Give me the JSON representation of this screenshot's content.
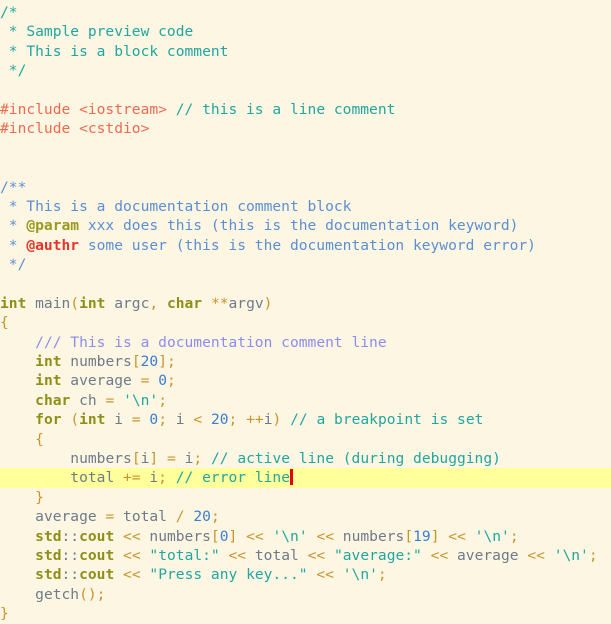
{
  "editor": {
    "name": "code-preview-pane",
    "language": "C++",
    "background_color": "#fdf6e3",
    "highlight_color": "#ffff9c",
    "caret_color": "#e8000d",
    "colors": {
      "comment": "#21a6a0",
      "doc_comment": "#5b8fd4",
      "doc_comment_line": "#8d8df0",
      "doc_keyword": "#9a9a1f",
      "doc_keyword_error": "#e8332a",
      "keyword": "#8f8f18",
      "preprocessor": "#f06a50",
      "number": "#3a7ecf",
      "string": "#21a6a0",
      "punctuation": "#c9942c",
      "identifier": "#6e7b8b"
    }
  },
  "lines": [
    {
      "highlight": false,
      "caret": false,
      "tokens": [
        {
          "t": "/*",
          "c": "comment"
        }
      ]
    },
    {
      "highlight": false,
      "caret": false,
      "tokens": [
        {
          "t": " * Sample preview code",
          "c": "comment"
        }
      ]
    },
    {
      "highlight": false,
      "caret": false,
      "tokens": [
        {
          "t": " * This is a block comment",
          "c": "comment"
        }
      ]
    },
    {
      "highlight": false,
      "caret": false,
      "tokens": [
        {
          "t": " */",
          "c": "comment"
        }
      ]
    },
    {
      "highlight": false,
      "caret": false,
      "tokens": [
        {
          "t": "",
          "c": "plain"
        }
      ]
    },
    {
      "highlight": false,
      "caret": false,
      "tokens": [
        {
          "t": "#include <iostream> ",
          "c": "preproc"
        },
        {
          "t": "// this is a line comment",
          "c": "comment"
        }
      ]
    },
    {
      "highlight": false,
      "caret": false,
      "tokens": [
        {
          "t": "#include <cstdio>",
          "c": "preproc"
        }
      ]
    },
    {
      "highlight": false,
      "caret": false,
      "tokens": [
        {
          "t": "",
          "c": "plain"
        }
      ]
    },
    {
      "highlight": false,
      "caret": false,
      "tokens": [
        {
          "t": "",
          "c": "plain"
        }
      ]
    },
    {
      "highlight": false,
      "caret": false,
      "tokens": [
        {
          "t": "/**",
          "c": "doc"
        }
      ]
    },
    {
      "highlight": false,
      "caret": false,
      "tokens": [
        {
          "t": " * This is a documentation comment block",
          "c": "doc"
        }
      ]
    },
    {
      "highlight": false,
      "caret": false,
      "tokens": [
        {
          "t": " * ",
          "c": "doc"
        },
        {
          "t": "@param",
          "c": "dockey"
        },
        {
          "t": " xxx does this (this is the documentation keyword)",
          "c": "doc"
        }
      ]
    },
    {
      "highlight": false,
      "caret": false,
      "tokens": [
        {
          "t": " * ",
          "c": "doc"
        },
        {
          "t": "@authr",
          "c": "dockeyerr"
        },
        {
          "t": " some user (this is the documentation keyword error)",
          "c": "doc"
        }
      ]
    },
    {
      "highlight": false,
      "caret": false,
      "tokens": [
        {
          "t": " */",
          "c": "doc"
        }
      ]
    },
    {
      "highlight": false,
      "caret": false,
      "tokens": [
        {
          "t": "",
          "c": "plain"
        }
      ]
    },
    {
      "highlight": false,
      "caret": false,
      "tokens": [
        {
          "t": "int",
          "c": "keyword"
        },
        {
          "t": " main",
          "c": "ident"
        },
        {
          "t": "(",
          "c": "punct"
        },
        {
          "t": "int",
          "c": "keyword"
        },
        {
          "t": " argc",
          "c": "ident"
        },
        {
          "t": ",",
          "c": "punct"
        },
        {
          "t": " ",
          "c": "plain"
        },
        {
          "t": "char",
          "c": "keyword"
        },
        {
          "t": " ",
          "c": "plain"
        },
        {
          "t": "**",
          "c": "op"
        },
        {
          "t": "argv",
          "c": "ident"
        },
        {
          "t": ")",
          "c": "punct"
        }
      ]
    },
    {
      "highlight": false,
      "caret": false,
      "tokens": [
        {
          "t": "{",
          "c": "punct"
        }
      ]
    },
    {
      "highlight": false,
      "caret": false,
      "tokens": [
        {
          "t": "    ",
          "c": "plain"
        },
        {
          "t": "/// This is a documentation comment line",
          "c": "docline"
        }
      ]
    },
    {
      "highlight": false,
      "caret": false,
      "tokens": [
        {
          "t": "    ",
          "c": "plain"
        },
        {
          "t": "int",
          "c": "keyword"
        },
        {
          "t": " numbers",
          "c": "ident"
        },
        {
          "t": "[",
          "c": "punct"
        },
        {
          "t": "20",
          "c": "number"
        },
        {
          "t": "]",
          "c": "punct"
        },
        {
          "t": ";",
          "c": "punct"
        }
      ]
    },
    {
      "highlight": false,
      "caret": false,
      "tokens": [
        {
          "t": "    ",
          "c": "plain"
        },
        {
          "t": "int",
          "c": "keyword"
        },
        {
          "t": " average ",
          "c": "ident"
        },
        {
          "t": "=",
          "c": "op"
        },
        {
          "t": " ",
          "c": "plain"
        },
        {
          "t": "0",
          "c": "number"
        },
        {
          "t": ";",
          "c": "punct"
        }
      ]
    },
    {
      "highlight": false,
      "caret": false,
      "tokens": [
        {
          "t": "    ",
          "c": "plain"
        },
        {
          "t": "char",
          "c": "keyword"
        },
        {
          "t": " ch ",
          "c": "ident"
        },
        {
          "t": "=",
          "c": "op"
        },
        {
          "t": " ",
          "c": "plain"
        },
        {
          "t": "'\\n'",
          "c": "string"
        },
        {
          "t": ";",
          "c": "punct"
        }
      ]
    },
    {
      "highlight": false,
      "caret": false,
      "tokens": [
        {
          "t": "    ",
          "c": "plain"
        },
        {
          "t": "for",
          "c": "keyword"
        },
        {
          "t": " ",
          "c": "plain"
        },
        {
          "t": "(",
          "c": "punct"
        },
        {
          "t": "int",
          "c": "keyword"
        },
        {
          "t": " i ",
          "c": "ident"
        },
        {
          "t": "=",
          "c": "op"
        },
        {
          "t": " ",
          "c": "plain"
        },
        {
          "t": "0",
          "c": "number"
        },
        {
          "t": ";",
          "c": "punct"
        },
        {
          "t": " i ",
          "c": "ident"
        },
        {
          "t": "<",
          "c": "op"
        },
        {
          "t": " ",
          "c": "plain"
        },
        {
          "t": "20",
          "c": "number"
        },
        {
          "t": ";",
          "c": "punct"
        },
        {
          "t": " ",
          "c": "plain"
        },
        {
          "t": "++",
          "c": "op"
        },
        {
          "t": "i",
          "c": "ident"
        },
        {
          "t": ")",
          "c": "punct"
        },
        {
          "t": " ",
          "c": "plain"
        },
        {
          "t": "// a breakpoint is set",
          "c": "comment"
        }
      ]
    },
    {
      "highlight": false,
      "caret": false,
      "tokens": [
        {
          "t": "    ",
          "c": "plain"
        },
        {
          "t": "{",
          "c": "punct"
        }
      ]
    },
    {
      "highlight": false,
      "caret": false,
      "tokens": [
        {
          "t": "        ",
          "c": "plain"
        },
        {
          "t": "numbers",
          "c": "ident"
        },
        {
          "t": "[",
          "c": "punct"
        },
        {
          "t": "i",
          "c": "ident"
        },
        {
          "t": "]",
          "c": "punct"
        },
        {
          "t": " ",
          "c": "plain"
        },
        {
          "t": "=",
          "c": "op"
        },
        {
          "t": " i",
          "c": "ident"
        },
        {
          "t": ";",
          "c": "punct"
        },
        {
          "t": " ",
          "c": "plain"
        },
        {
          "t": "// active line (during debugging)",
          "c": "comment"
        }
      ]
    },
    {
      "highlight": true,
      "caret": true,
      "tokens": [
        {
          "t": "        ",
          "c": "plain"
        },
        {
          "t": "total ",
          "c": "ident"
        },
        {
          "t": "+=",
          "c": "op"
        },
        {
          "t": " i",
          "c": "ident"
        },
        {
          "t": ";",
          "c": "punct"
        },
        {
          "t": " ",
          "c": "plain"
        },
        {
          "t": "// error line",
          "c": "comment"
        }
      ]
    },
    {
      "highlight": false,
      "caret": false,
      "tokens": [
        {
          "t": "    ",
          "c": "plain"
        },
        {
          "t": "}",
          "c": "punct"
        }
      ]
    },
    {
      "highlight": false,
      "caret": false,
      "tokens": [
        {
          "t": "    ",
          "c": "plain"
        },
        {
          "t": "average ",
          "c": "ident"
        },
        {
          "t": "=",
          "c": "op"
        },
        {
          "t": " total ",
          "c": "ident"
        },
        {
          "t": "/",
          "c": "op"
        },
        {
          "t": " ",
          "c": "plain"
        },
        {
          "t": "20",
          "c": "number"
        },
        {
          "t": ";",
          "c": "punct"
        }
      ]
    },
    {
      "highlight": false,
      "caret": false,
      "tokens": [
        {
          "t": "    ",
          "c": "plain"
        },
        {
          "t": "std",
          "c": "keyword"
        },
        {
          "t": "::",
          "c": "plain"
        },
        {
          "t": "cout",
          "c": "keyword"
        },
        {
          "t": " ",
          "c": "plain"
        },
        {
          "t": "<<",
          "c": "op"
        },
        {
          "t": " numbers",
          "c": "ident"
        },
        {
          "t": "[",
          "c": "punct"
        },
        {
          "t": "0",
          "c": "number"
        },
        {
          "t": "]",
          "c": "punct"
        },
        {
          "t": " ",
          "c": "plain"
        },
        {
          "t": "<<",
          "c": "op"
        },
        {
          "t": " ",
          "c": "plain"
        },
        {
          "t": "'\\n'",
          "c": "string"
        },
        {
          "t": " ",
          "c": "plain"
        },
        {
          "t": "<<",
          "c": "op"
        },
        {
          "t": " numbers",
          "c": "ident"
        },
        {
          "t": "[",
          "c": "punct"
        },
        {
          "t": "19",
          "c": "number"
        },
        {
          "t": "]",
          "c": "punct"
        },
        {
          "t": " ",
          "c": "plain"
        },
        {
          "t": "<<",
          "c": "op"
        },
        {
          "t": " ",
          "c": "plain"
        },
        {
          "t": "'\\n'",
          "c": "string"
        },
        {
          "t": ";",
          "c": "punct"
        }
      ]
    },
    {
      "highlight": false,
      "caret": false,
      "tokens": [
        {
          "t": "    ",
          "c": "plain"
        },
        {
          "t": "std",
          "c": "keyword"
        },
        {
          "t": "::",
          "c": "plain"
        },
        {
          "t": "cout",
          "c": "keyword"
        },
        {
          "t": " ",
          "c": "plain"
        },
        {
          "t": "<<",
          "c": "op"
        },
        {
          "t": " ",
          "c": "plain"
        },
        {
          "t": "\"total:\"",
          "c": "string"
        },
        {
          "t": " ",
          "c": "plain"
        },
        {
          "t": "<<",
          "c": "op"
        },
        {
          "t": " total ",
          "c": "ident"
        },
        {
          "t": "<<",
          "c": "op"
        },
        {
          "t": " ",
          "c": "plain"
        },
        {
          "t": "\"average:\"",
          "c": "string"
        },
        {
          "t": " ",
          "c": "plain"
        },
        {
          "t": "<<",
          "c": "op"
        },
        {
          "t": " average ",
          "c": "ident"
        },
        {
          "t": "<<",
          "c": "op"
        },
        {
          "t": " ",
          "c": "plain"
        },
        {
          "t": "'\\n'",
          "c": "string"
        },
        {
          "t": ";",
          "c": "punct"
        }
      ]
    },
    {
      "highlight": false,
      "caret": false,
      "tokens": [
        {
          "t": "    ",
          "c": "plain"
        },
        {
          "t": "std",
          "c": "keyword"
        },
        {
          "t": "::",
          "c": "plain"
        },
        {
          "t": "cout",
          "c": "keyword"
        },
        {
          "t": " ",
          "c": "plain"
        },
        {
          "t": "<<",
          "c": "op"
        },
        {
          "t": " ",
          "c": "plain"
        },
        {
          "t": "\"Press any key...\"",
          "c": "string"
        },
        {
          "t": " ",
          "c": "plain"
        },
        {
          "t": "<<",
          "c": "op"
        },
        {
          "t": " ",
          "c": "plain"
        },
        {
          "t": "'\\n'",
          "c": "string"
        },
        {
          "t": ";",
          "c": "punct"
        }
      ]
    },
    {
      "highlight": false,
      "caret": false,
      "tokens": [
        {
          "t": "    ",
          "c": "plain"
        },
        {
          "t": "getch",
          "c": "ident"
        },
        {
          "t": "()",
          "c": "punct"
        },
        {
          "t": ";",
          "c": "punct"
        }
      ]
    },
    {
      "highlight": false,
      "caret": false,
      "tokens": [
        {
          "t": "}",
          "c": "punct"
        }
      ]
    }
  ]
}
